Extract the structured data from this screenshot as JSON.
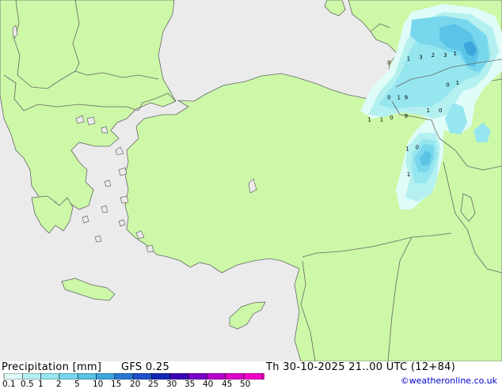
{
  "footer": {
    "product": "Precipitation [mm]",
    "model": "GFS 0.25",
    "valid_time": "Th 30-10-2025 21..00 UTC (12+84)",
    "credit": "©weatheronline.co.uk"
  },
  "legend": {
    "labels": [
      "0.1",
      "0.5",
      "1",
      "2",
      "5",
      "10",
      "15",
      "20",
      "25",
      "30",
      "35",
      "40",
      "45",
      "50"
    ],
    "colors": [
      "#e0fcf8",
      "#b4f0f0",
      "#96e6f0",
      "#78d7ec",
      "#5ac3e6",
      "#3ca5dc",
      "#2878d2",
      "#1e50c8",
      "#1428b4",
      "#3c00b4",
      "#7800c8",
      "#b400c8",
      "#dc00c8",
      "#f000c8"
    ]
  },
  "map": {
    "colors": {
      "sea": "#ebebeb",
      "land": "#ccf8a8",
      "border": "#666666"
    },
    "precip_values": [
      {
        "text": "0",
        "lon": 35.9,
        "lat": 43.55
      },
      {
        "text": "1",
        "lon": 36.7,
        "lat": 43.65
      },
      {
        "text": "3",
        "lon": 37.2,
        "lat": 43.7
      },
      {
        "text": "2",
        "lon": 37.7,
        "lat": 43.75
      },
      {
        "text": "3",
        "lon": 38.2,
        "lat": 43.75
      },
      {
        "text": "1",
        "lon": 38.6,
        "lat": 43.8
      },
      {
        "text": "1",
        "lon": 38.7,
        "lat": 43.0
      },
      {
        "text": "0",
        "lon": 38.3,
        "lat": 42.95
      },
      {
        "text": "0",
        "lon": 35.9,
        "lat": 42.6
      },
      {
        "text": "1",
        "lon": 36.3,
        "lat": 42.6
      },
      {
        "text": "9",
        "lon": 36.6,
        "lat": 42.6
      },
      {
        "text": "1",
        "lon": 35.1,
        "lat": 42.0
      },
      {
        "text": "1",
        "lon": 35.6,
        "lat": 42.0
      },
      {
        "text": "0",
        "lon": 36.0,
        "lat": 42.05
      },
      {
        "text": "9",
        "lon": 36.6,
        "lat": 42.1
      },
      {
        "text": "1",
        "lon": 37.5,
        "lat": 42.25
      },
      {
        "text": "0",
        "lon": 38.0,
        "lat": 42.25
      },
      {
        "text": "1",
        "lon": 36.65,
        "lat": 41.2
      },
      {
        "text": "0",
        "lon": 37.05,
        "lat": 41.25
      },
      {
        "text": "1",
        "lon": 36.7,
        "lat": 40.5
      }
    ]
  }
}
